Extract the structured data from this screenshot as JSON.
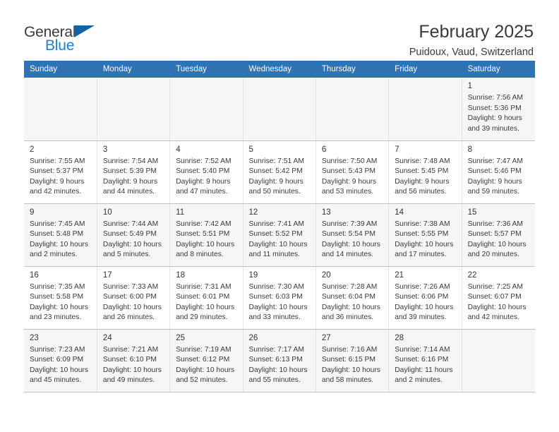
{
  "brand": {
    "name_top": "General",
    "name_bottom": "Blue",
    "accent_color": "#1f7fd0",
    "triangle_color": "#1362a8"
  },
  "header": {
    "title": "February 2025",
    "subtitle": "Puidoux, Vaud, Switzerland"
  },
  "calendar": {
    "header_bg": "#3073b5",
    "weekday_headers": [
      "Sunday",
      "Monday",
      "Tuesday",
      "Wednesday",
      "Thursday",
      "Friday",
      "Saturday"
    ],
    "weeks": [
      [
        {
          "day": "",
          "detail": ""
        },
        {
          "day": "",
          "detail": ""
        },
        {
          "day": "",
          "detail": ""
        },
        {
          "day": "",
          "detail": ""
        },
        {
          "day": "",
          "detail": ""
        },
        {
          "day": "",
          "detail": ""
        },
        {
          "day": "1",
          "detail": "Sunrise: 7:56 AM\nSunset: 5:36 PM\nDaylight: 9 hours\nand 39 minutes."
        }
      ],
      [
        {
          "day": "2",
          "detail": "Sunrise: 7:55 AM\nSunset: 5:37 PM\nDaylight: 9 hours\nand 42 minutes."
        },
        {
          "day": "3",
          "detail": "Sunrise: 7:54 AM\nSunset: 5:39 PM\nDaylight: 9 hours\nand 44 minutes."
        },
        {
          "day": "4",
          "detail": "Sunrise: 7:52 AM\nSunset: 5:40 PM\nDaylight: 9 hours\nand 47 minutes."
        },
        {
          "day": "5",
          "detail": "Sunrise: 7:51 AM\nSunset: 5:42 PM\nDaylight: 9 hours\nand 50 minutes."
        },
        {
          "day": "6",
          "detail": "Sunrise: 7:50 AM\nSunset: 5:43 PM\nDaylight: 9 hours\nand 53 minutes."
        },
        {
          "day": "7",
          "detail": "Sunrise: 7:48 AM\nSunset: 5:45 PM\nDaylight: 9 hours\nand 56 minutes."
        },
        {
          "day": "8",
          "detail": "Sunrise: 7:47 AM\nSunset: 5:46 PM\nDaylight: 9 hours\nand 59 minutes."
        }
      ],
      [
        {
          "day": "9",
          "detail": "Sunrise: 7:45 AM\nSunset: 5:48 PM\nDaylight: 10 hours\nand 2 minutes."
        },
        {
          "day": "10",
          "detail": "Sunrise: 7:44 AM\nSunset: 5:49 PM\nDaylight: 10 hours\nand 5 minutes."
        },
        {
          "day": "11",
          "detail": "Sunrise: 7:42 AM\nSunset: 5:51 PM\nDaylight: 10 hours\nand 8 minutes."
        },
        {
          "day": "12",
          "detail": "Sunrise: 7:41 AM\nSunset: 5:52 PM\nDaylight: 10 hours\nand 11 minutes."
        },
        {
          "day": "13",
          "detail": "Sunrise: 7:39 AM\nSunset: 5:54 PM\nDaylight: 10 hours\nand 14 minutes."
        },
        {
          "day": "14",
          "detail": "Sunrise: 7:38 AM\nSunset: 5:55 PM\nDaylight: 10 hours\nand 17 minutes."
        },
        {
          "day": "15",
          "detail": "Sunrise: 7:36 AM\nSunset: 5:57 PM\nDaylight: 10 hours\nand 20 minutes."
        }
      ],
      [
        {
          "day": "16",
          "detail": "Sunrise: 7:35 AM\nSunset: 5:58 PM\nDaylight: 10 hours\nand 23 minutes."
        },
        {
          "day": "17",
          "detail": "Sunrise: 7:33 AM\nSunset: 6:00 PM\nDaylight: 10 hours\nand 26 minutes."
        },
        {
          "day": "18",
          "detail": "Sunrise: 7:31 AM\nSunset: 6:01 PM\nDaylight: 10 hours\nand 29 minutes."
        },
        {
          "day": "19",
          "detail": "Sunrise: 7:30 AM\nSunset: 6:03 PM\nDaylight: 10 hours\nand 33 minutes."
        },
        {
          "day": "20",
          "detail": "Sunrise: 7:28 AM\nSunset: 6:04 PM\nDaylight: 10 hours\nand 36 minutes."
        },
        {
          "day": "21",
          "detail": "Sunrise: 7:26 AM\nSunset: 6:06 PM\nDaylight: 10 hours\nand 39 minutes."
        },
        {
          "day": "22",
          "detail": "Sunrise: 7:25 AM\nSunset: 6:07 PM\nDaylight: 10 hours\nand 42 minutes."
        }
      ],
      [
        {
          "day": "23",
          "detail": "Sunrise: 7:23 AM\nSunset: 6:09 PM\nDaylight: 10 hours\nand 45 minutes."
        },
        {
          "day": "24",
          "detail": "Sunrise: 7:21 AM\nSunset: 6:10 PM\nDaylight: 10 hours\nand 49 minutes."
        },
        {
          "day": "25",
          "detail": "Sunrise: 7:19 AM\nSunset: 6:12 PM\nDaylight: 10 hours\nand 52 minutes."
        },
        {
          "day": "26",
          "detail": "Sunrise: 7:17 AM\nSunset: 6:13 PM\nDaylight: 10 hours\nand 55 minutes."
        },
        {
          "day": "27",
          "detail": "Sunrise: 7:16 AM\nSunset: 6:15 PM\nDaylight: 10 hours\nand 58 minutes."
        },
        {
          "day": "28",
          "detail": "Sunrise: 7:14 AM\nSunset: 6:16 PM\nDaylight: 11 hours\nand 2 minutes."
        },
        {
          "day": "",
          "detail": ""
        }
      ]
    ]
  }
}
